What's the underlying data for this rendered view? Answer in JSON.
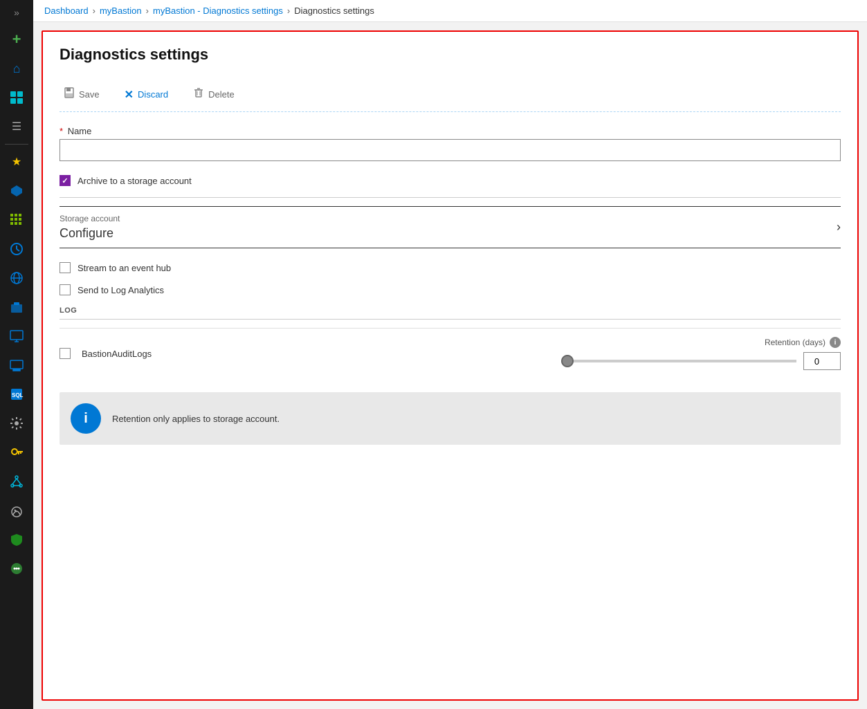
{
  "breadcrumb": {
    "items": [
      {
        "label": "Dashboard",
        "link": true
      },
      {
        "label": "myBastion",
        "link": true
      },
      {
        "label": "myBastion - Diagnostics settings",
        "link": true
      },
      {
        "label": "Diagnostics settings",
        "link": false
      }
    ]
  },
  "page": {
    "title": "Diagnostics settings"
  },
  "toolbar": {
    "save_label": "Save",
    "discard_label": "Discard",
    "delete_label": "Delete"
  },
  "form": {
    "name_label": "Name",
    "name_placeholder": "",
    "archive_label": "Archive to a storage account",
    "archive_checked": true,
    "storage_account_label": "Storage account",
    "storage_configure": "Configure",
    "stream_label": "Stream to an event hub",
    "stream_checked": false,
    "send_log_label": "Send to Log Analytics",
    "send_log_checked": false
  },
  "log_section": {
    "header": "LOG",
    "rows": [
      {
        "name": "BastionAuditLogs",
        "checked": false,
        "retention_label": "Retention (days)",
        "retention_value": 0,
        "slider_min": 0,
        "slider_max": 365,
        "slider_value": 0
      }
    ]
  },
  "info_banner": {
    "text": "Retention only applies to storage account."
  },
  "sidebar": {
    "items": [
      {
        "icon": "chevron-right",
        "label": "Collapse"
      },
      {
        "icon": "plus",
        "label": "Create"
      },
      {
        "icon": "home",
        "label": "Home"
      },
      {
        "icon": "dashboard",
        "label": "Dashboard"
      },
      {
        "icon": "menu",
        "label": "Menu"
      },
      {
        "icon": "star",
        "label": "Favorites"
      },
      {
        "icon": "cube",
        "label": "Resources"
      },
      {
        "icon": "grid",
        "label": "All services"
      },
      {
        "icon": "clock",
        "label": "Recent"
      },
      {
        "icon": "globe",
        "label": "Subscriptions"
      },
      {
        "icon": "box",
        "label": "Resource groups"
      },
      {
        "icon": "monitor",
        "label": "Virtual machines"
      },
      {
        "icon": "monitor2",
        "label": "App services"
      },
      {
        "icon": "sql",
        "label": "SQL databases"
      },
      {
        "icon": "gear",
        "label": "Azure services"
      },
      {
        "icon": "key",
        "label": "Key vaults"
      },
      {
        "icon": "network",
        "label": "Virtual networks"
      },
      {
        "icon": "speed",
        "label": "Monitor"
      },
      {
        "icon": "shield",
        "label": "Microsoft Defender"
      },
      {
        "icon": "dot",
        "label": "More"
      }
    ]
  }
}
